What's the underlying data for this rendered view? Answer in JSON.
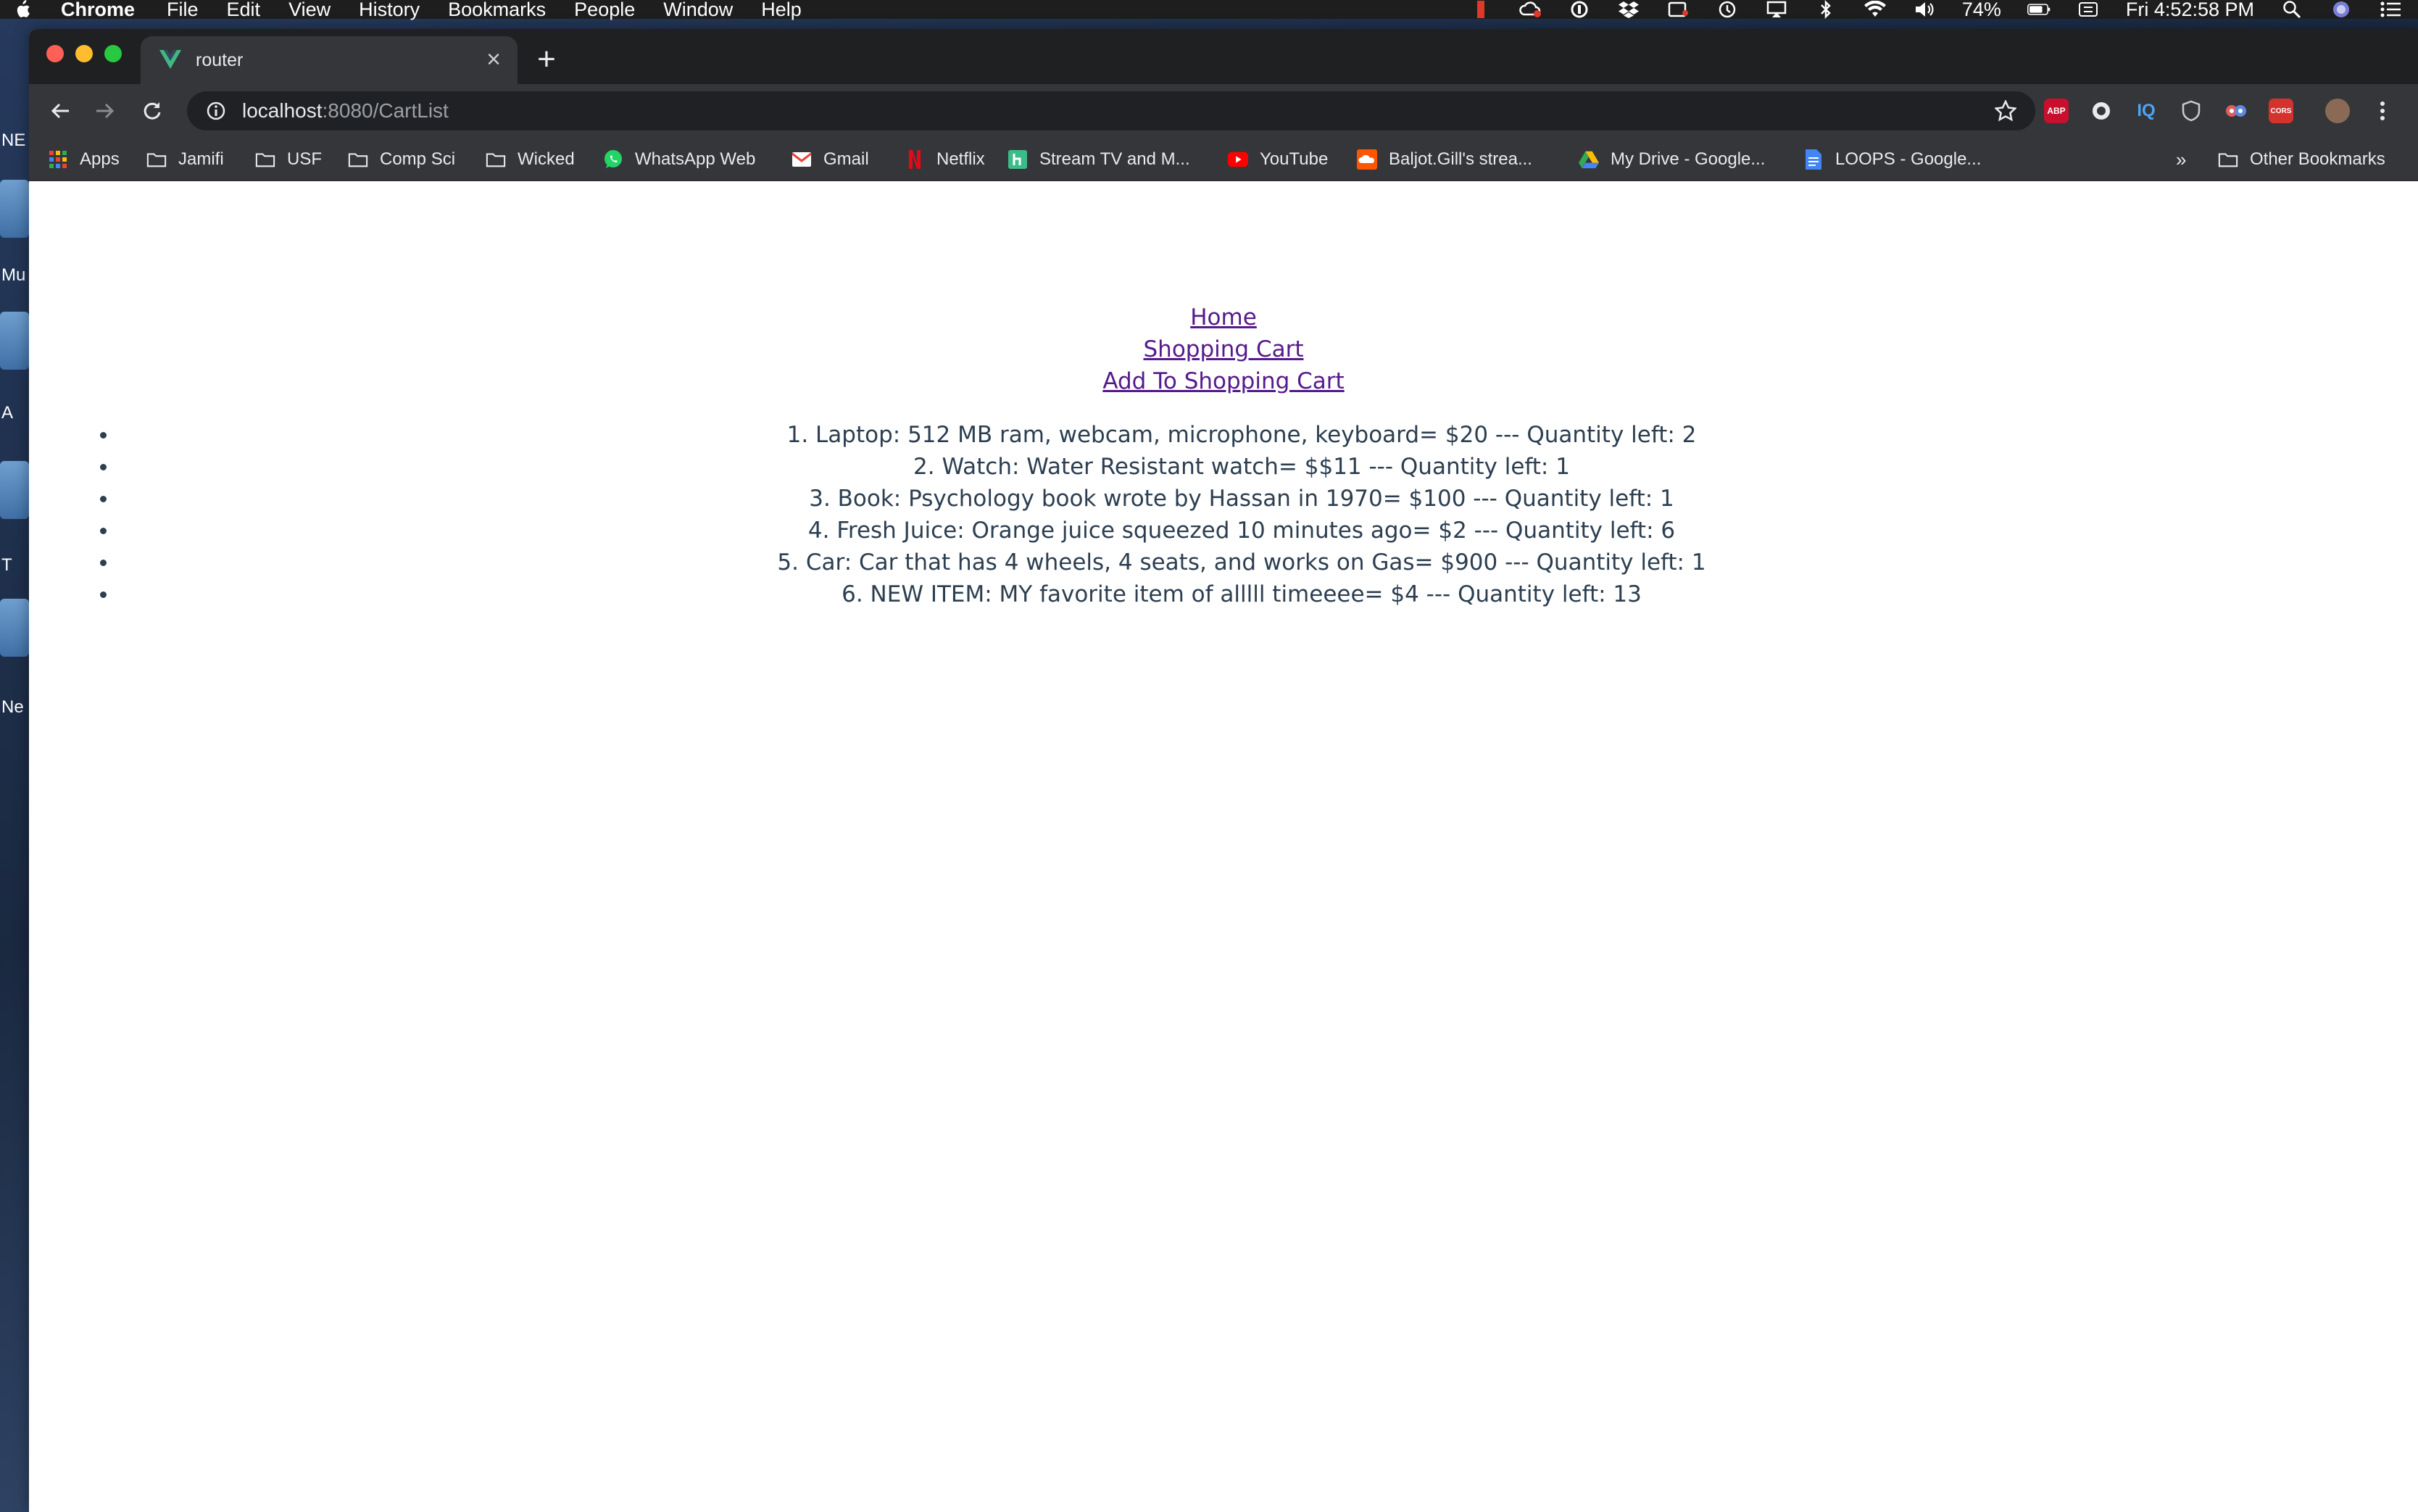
{
  "menubar": {
    "app_name": "Chrome",
    "items": [
      "File",
      "Edit",
      "View",
      "History",
      "Bookmarks",
      "People",
      "Window",
      "Help"
    ],
    "battery": "74%",
    "clock": "Fri 4:52:58 PM"
  },
  "desktop": {
    "labels": [
      "NE",
      "Mu",
      "A",
      "T",
      "Ne"
    ]
  },
  "browser": {
    "tab_title": "router",
    "url_host": "localhost",
    "url_rest": ":8080/CartList",
    "extensions": [
      "ABP",
      "IQ",
      "CORS"
    ],
    "bookmarks": [
      {
        "label": "Apps",
        "icon": "apps-grid-icon"
      },
      {
        "label": "Jamifi",
        "icon": "folder-icon"
      },
      {
        "label": "USF",
        "icon": "folder-icon"
      },
      {
        "label": "Comp Sci",
        "icon": "folder-icon"
      },
      {
        "label": "Wicked",
        "icon": "folder-icon"
      },
      {
        "label": "WhatsApp Web",
        "icon": "whatsapp-icon"
      },
      {
        "label": "Gmail",
        "icon": "gmail-icon"
      },
      {
        "label": "Netflix",
        "icon": "netflix-icon"
      },
      {
        "label": "Stream TV and M...",
        "icon": "hulu-icon"
      },
      {
        "label": "YouTube",
        "icon": "youtube-icon"
      },
      {
        "label": "Baljot.Gill's strea...",
        "icon": "soundcloud-icon"
      },
      {
        "label": "My Drive - Google...",
        "icon": "google-drive-icon"
      },
      {
        "label": "LOOPS - Google...",
        "icon": "google-docs-icon"
      }
    ],
    "overflow_label": "»",
    "other_bookmarks": "Other Bookmarks"
  },
  "page": {
    "nav": {
      "home": "Home",
      "shopping_cart": "Shopping Cart",
      "add_to_cart": "Add To Shopping Cart"
    },
    "items": [
      "1. Laptop: 512 MB ram, webcam, microphone, keyboard= $20 --- Quantity left: 2",
      "2. Watch: Water Resistant watch= $$11 --- Quantity left: 1",
      "3. Book: Psychology book wrote by Hassan in 1970= $100 --- Quantity left: 1",
      "4. Fresh Juice: Orange juice squeezed 10 minutes ago= $2 --- Quantity left: 6",
      "5. Car: Car that has 4 wheels, 4 seats, and works on Gas= $900 --- Quantity left: 1",
      "6. NEW ITEM: MY favorite item of alllll timeeee= $4 --- Quantity left: 13"
    ]
  },
  "colors": {
    "link": "#551a8b",
    "text": "#2c3e50",
    "chrome_dark": "#35363a"
  }
}
